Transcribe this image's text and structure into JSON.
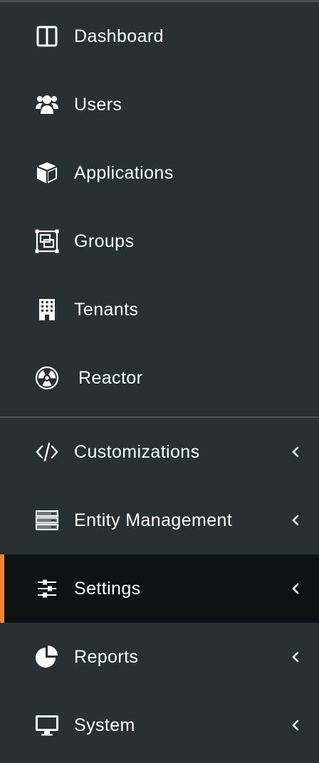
{
  "sidebar": {
    "primary_items": [
      {
        "label": "Dashboard",
        "icon": "dashboard-columns-icon"
      },
      {
        "label": "Users",
        "icon": "users-icon"
      },
      {
        "label": "Applications",
        "icon": "cube-icon"
      },
      {
        "label": "Groups",
        "icon": "object-group-icon"
      },
      {
        "label": "Tenants",
        "icon": "building-icon"
      },
      {
        "label": "Reactor",
        "icon": "radiation-icon"
      }
    ],
    "secondary_items": [
      {
        "label": "Customizations",
        "icon": "code-icon",
        "expandable": true
      },
      {
        "label": "Entity Management",
        "icon": "server-icon",
        "expandable": true
      },
      {
        "label": "Settings",
        "icon": "sliders-icon",
        "expandable": true,
        "active": true
      },
      {
        "label": "Reports",
        "icon": "chart-pie-icon",
        "expandable": true
      },
      {
        "label": "System",
        "icon": "desktop-icon",
        "expandable": true
      }
    ]
  },
  "colors": {
    "background": "#283033",
    "active_background": "#0e1213",
    "active_accent": "#f0882c",
    "divider": "#4a5256",
    "text": "#ffffff"
  }
}
